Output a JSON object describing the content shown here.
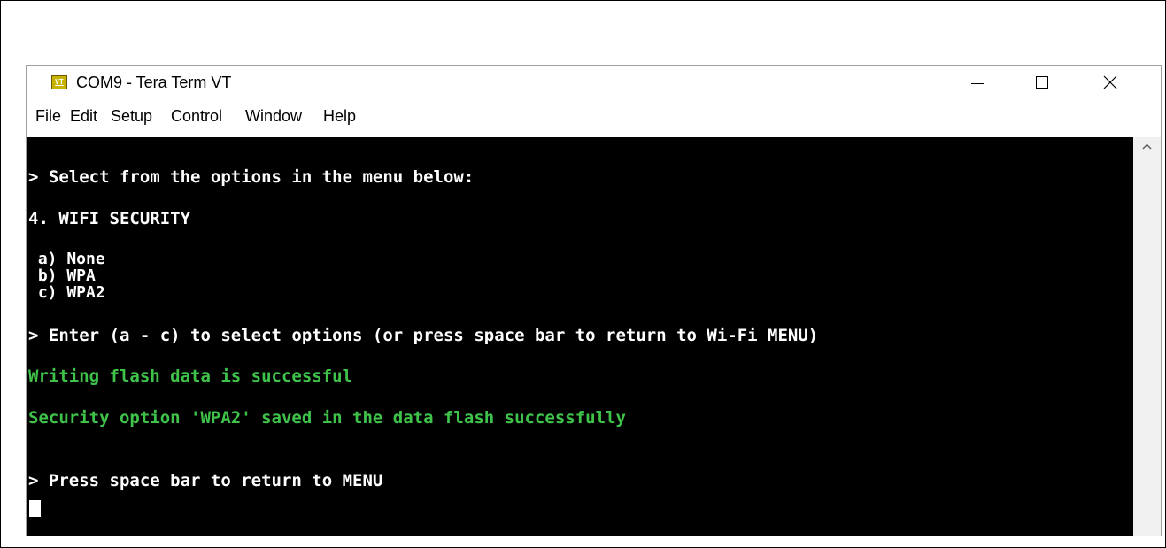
{
  "window": {
    "icon_text": "VT",
    "title": "COM9 - Tera Term VT"
  },
  "menu": [
    {
      "label": "File"
    },
    {
      "label": "Edit"
    },
    {
      "label": "Setup"
    },
    {
      "label": "Control"
    },
    {
      "label": "Window"
    },
    {
      "label": "Help"
    }
  ],
  "terminal": {
    "lines": [
      {
        "text": "> Select from the options in the menu below:",
        "color": "#ffffff"
      },
      {
        "text": "4. WIFI SECURITY",
        "color": "#ffffff"
      },
      {
        "text": " a) None",
        "color": "#ffffff"
      },
      {
        "text": " b) WPA",
        "color": "#ffffff"
      },
      {
        "text": " c) WPA2",
        "color": "#ffffff"
      },
      {
        "text": "> Enter (a - c) to select options (or press space bar to return to Wi-Fi MENU)",
        "color": "#ffffff"
      },
      {
        "text": "Writing flash data is successful",
        "color": "#3fc24a"
      },
      {
        "text": "Security option 'WPA2' saved in the data flash successfully",
        "color": "#3fc24a"
      },
      {
        "text": "> Press space bar to return to MENU",
        "color": "#ffffff"
      }
    ]
  }
}
